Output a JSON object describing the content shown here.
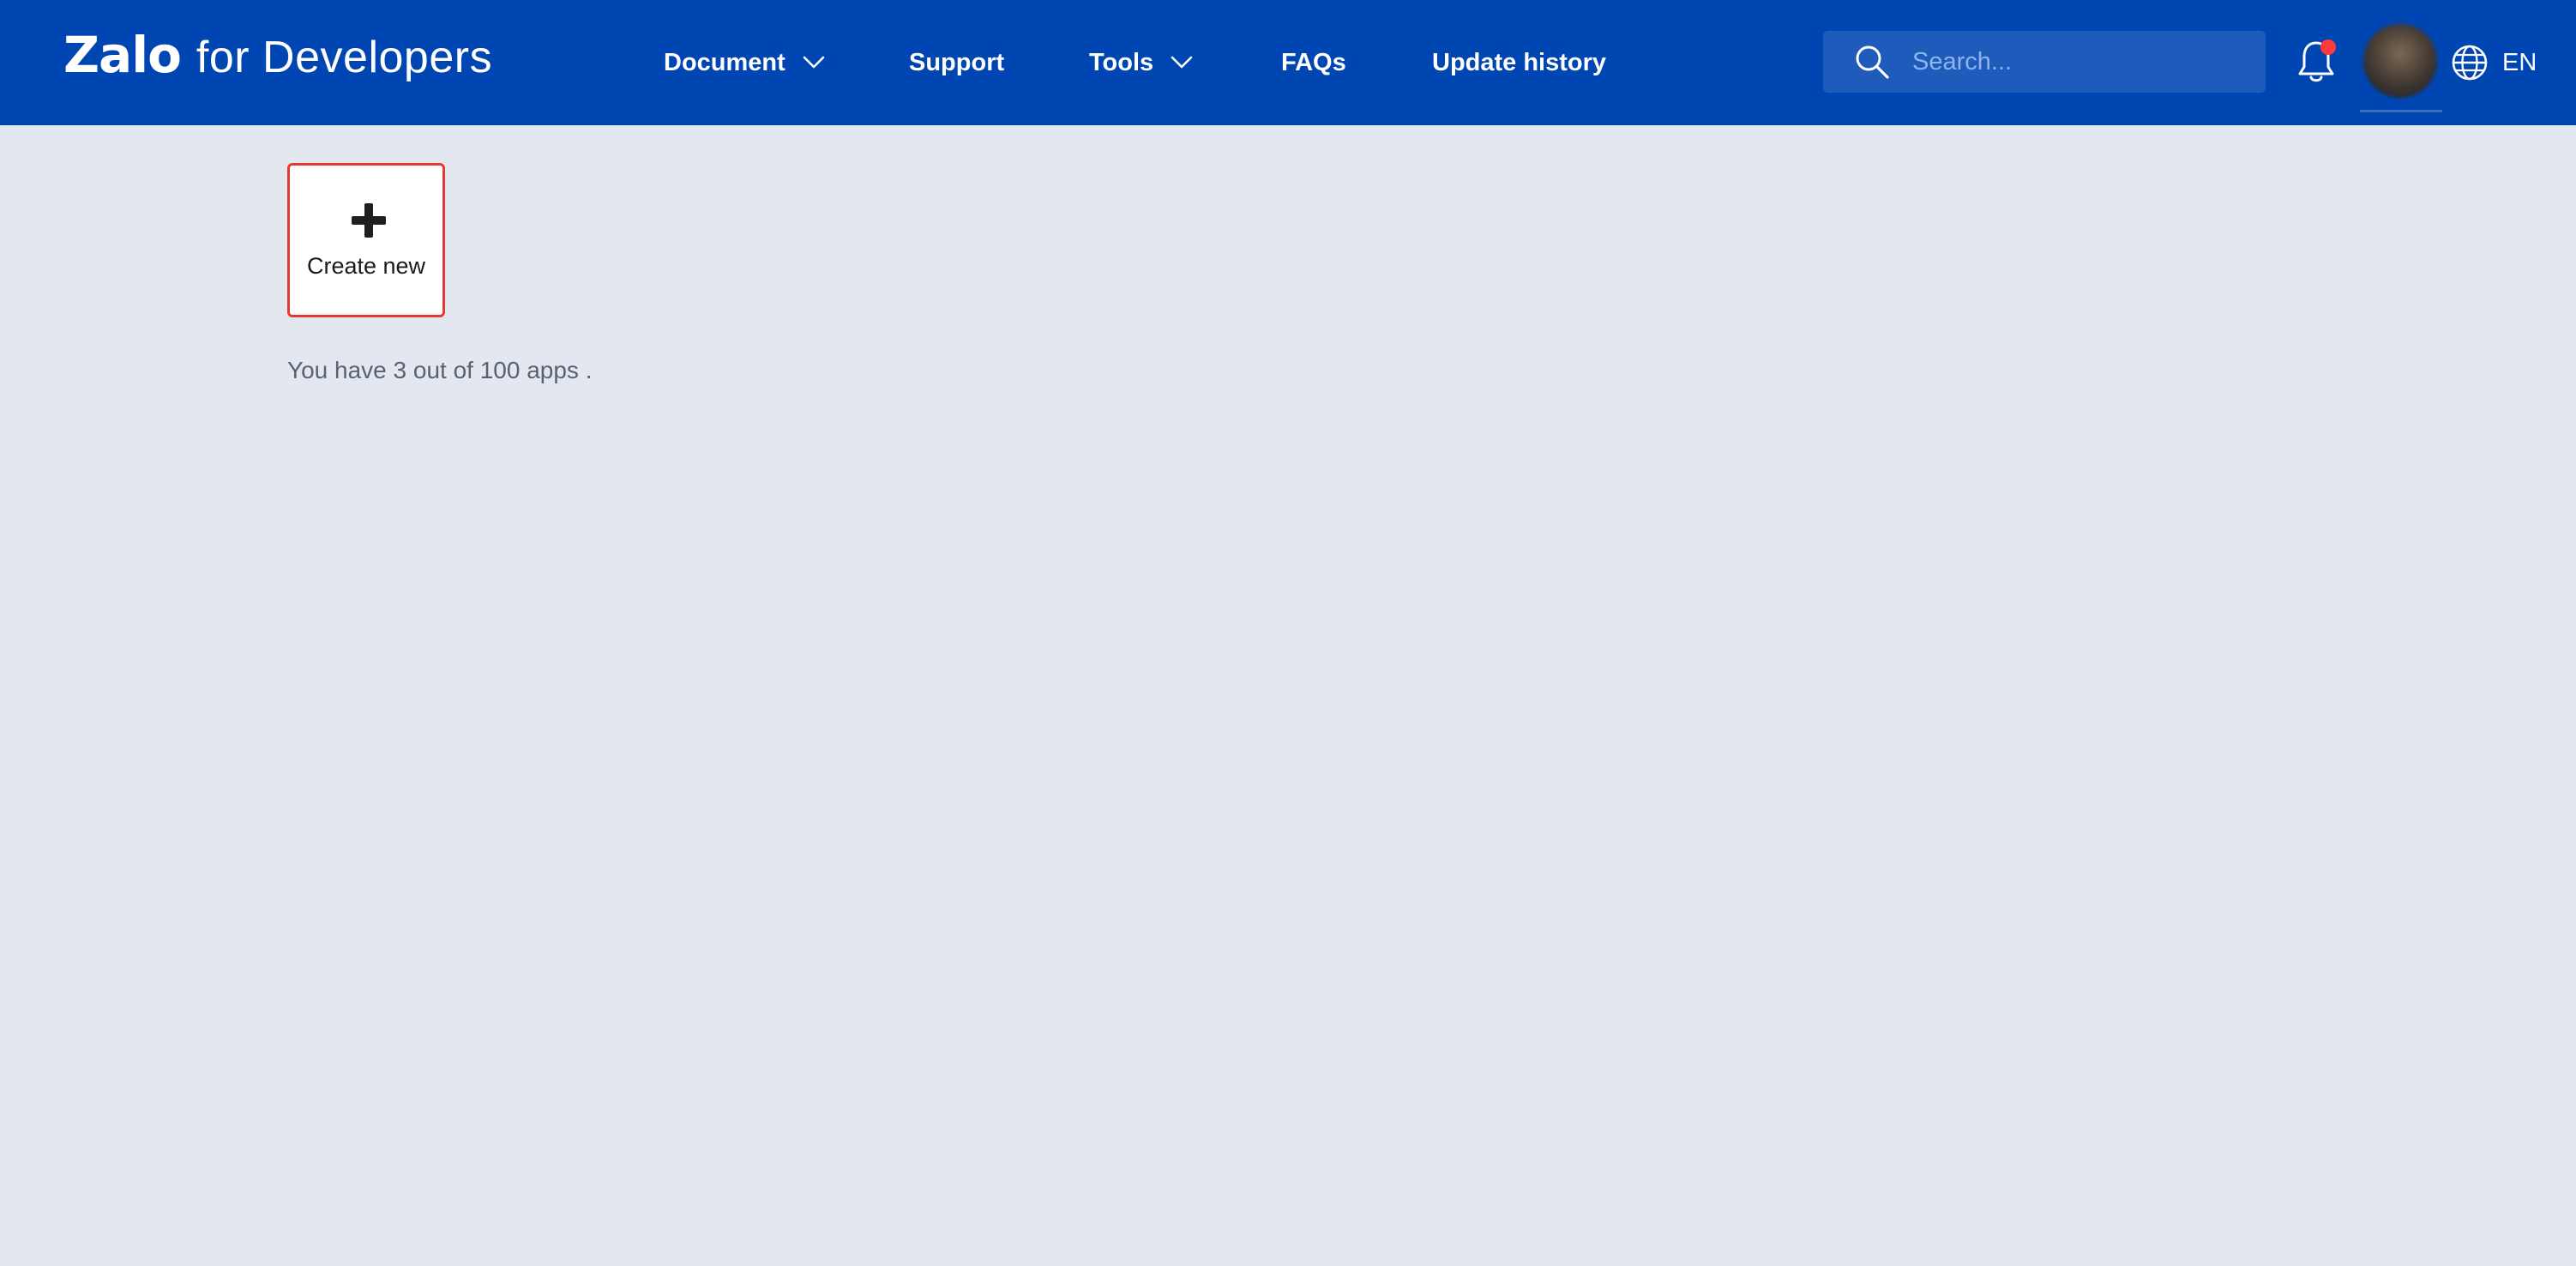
{
  "header": {
    "brand_primary": "Zalo",
    "brand_secondary": "for Developers",
    "nav": {
      "document": "Document",
      "support": "Support",
      "tools": "Tools",
      "faqs": "FAQs",
      "update_history": "Update history"
    },
    "search_placeholder": "Search...",
    "notification_badge_color": "#ff3b3b",
    "language": "EN"
  },
  "main": {
    "create_new_label": "Create new",
    "apps_count_text": "You have 3 out of 100 apps ."
  },
  "colors": {
    "header_bg": "#0046b2",
    "page_bg": "#e3e7f0",
    "card_border": "#e53935"
  },
  "icons": [
    "chevron-down-icon",
    "search-icon",
    "bell-icon",
    "globe-icon",
    "plus-icon"
  ]
}
